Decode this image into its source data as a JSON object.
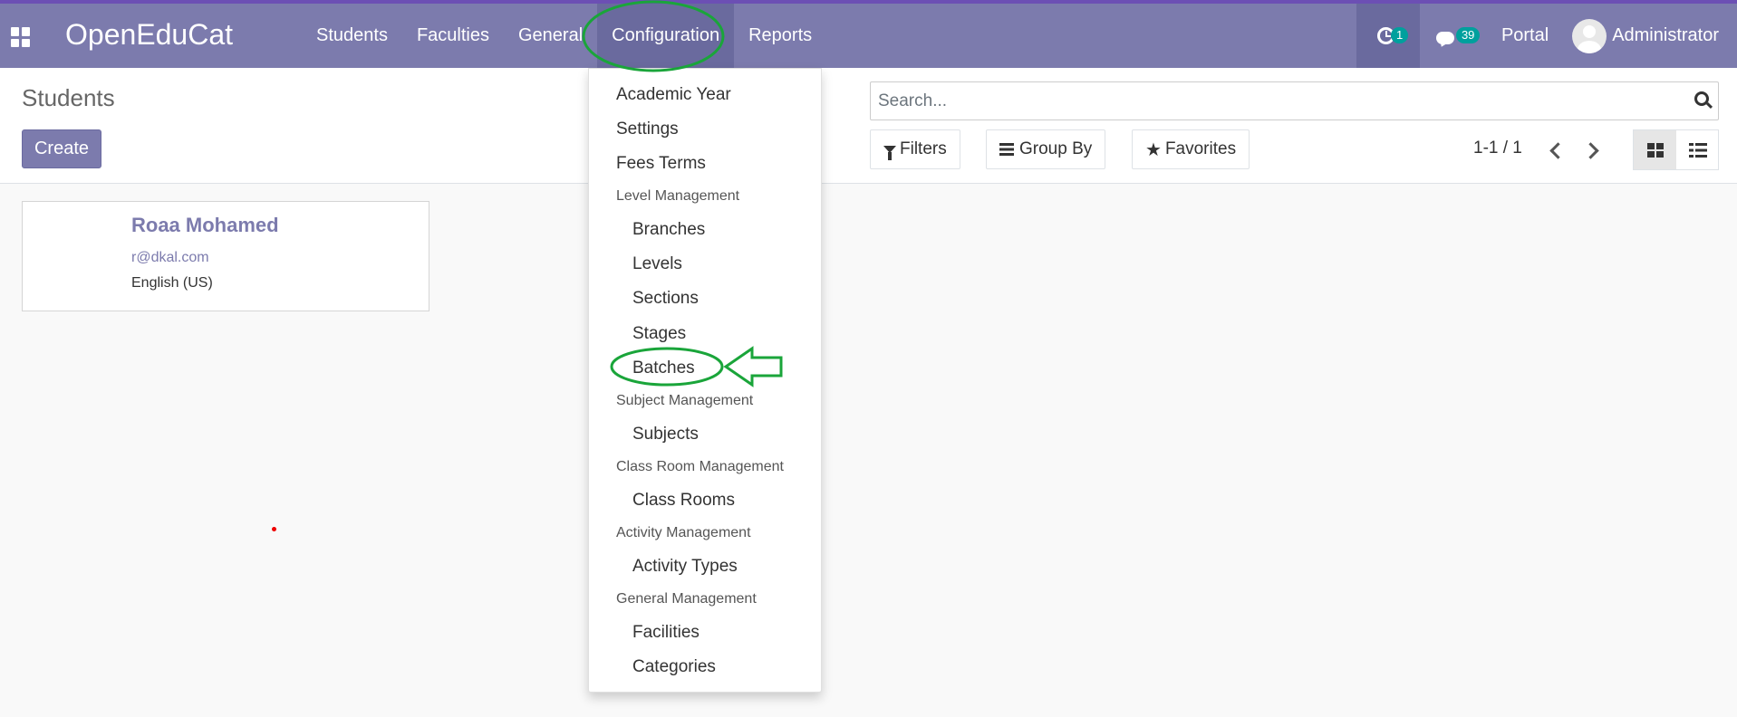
{
  "app": {
    "brand": "OpenEduCat"
  },
  "nav": {
    "menu": [
      {
        "label": "Students"
      },
      {
        "label": "Faculties"
      },
      {
        "label": "General"
      },
      {
        "label": "Configuration",
        "open": true
      },
      {
        "label": "Reports"
      }
    ],
    "activity_count": "1",
    "message_count": "39",
    "portal_label": "Portal",
    "user_name": "Administrator"
  },
  "control": {
    "title": "Students",
    "create_label": "Create",
    "search_placeholder": "Search...",
    "filters_label": "Filters",
    "groupby_label": "Group By",
    "favorites_label": "Favorites",
    "pager": "1-1 / 1"
  },
  "card": {
    "name": "Roaa Mohamed",
    "email": "r@dkal.com",
    "language": "English (US)"
  },
  "dropdown": {
    "academic_year": "Academic Year",
    "settings": "Settings",
    "fees_terms": "Fees Terms",
    "level_management": "Level Management",
    "branches": "Branches",
    "levels": "Levels",
    "sections": "Sections",
    "stages": "Stages",
    "batches": "Batches",
    "subject_management": "Subject Management",
    "subjects": "Subjects",
    "class_room_management": "Class Room Management",
    "class_rooms": "Class Rooms",
    "activity_management": "Activity Management",
    "activity_types": "Activity Types",
    "general_management": "General Management",
    "facilities": "Facilities",
    "categories": "Categories"
  },
  "colors": {
    "navbar": "#7c7bad",
    "accent_border": "#6c4fb4",
    "badge": "#00a09d",
    "annotation": "#1aa53a"
  }
}
